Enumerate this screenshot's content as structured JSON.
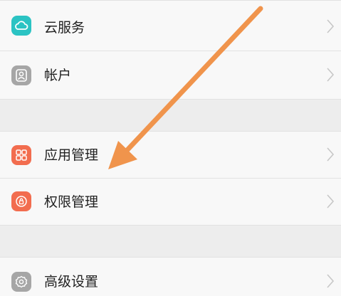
{
  "settings": {
    "items": [
      {
        "label": "云服务",
        "icon": "cloud-icon",
        "color": "#2bc3c3"
      },
      {
        "label": "帐户",
        "icon": "person-icon",
        "color": "#a6a6a6"
      },
      {
        "label": "应用管理",
        "icon": "apps-grid-icon",
        "color": "#f26d4f"
      },
      {
        "label": "权限管理",
        "icon": "lock-icon",
        "color": "#f26d4f"
      },
      {
        "label": "高级设置",
        "icon": "gear-icon",
        "color": "#a6a6a6"
      }
    ],
    "annotation_arrow_color": "#f0944c"
  }
}
